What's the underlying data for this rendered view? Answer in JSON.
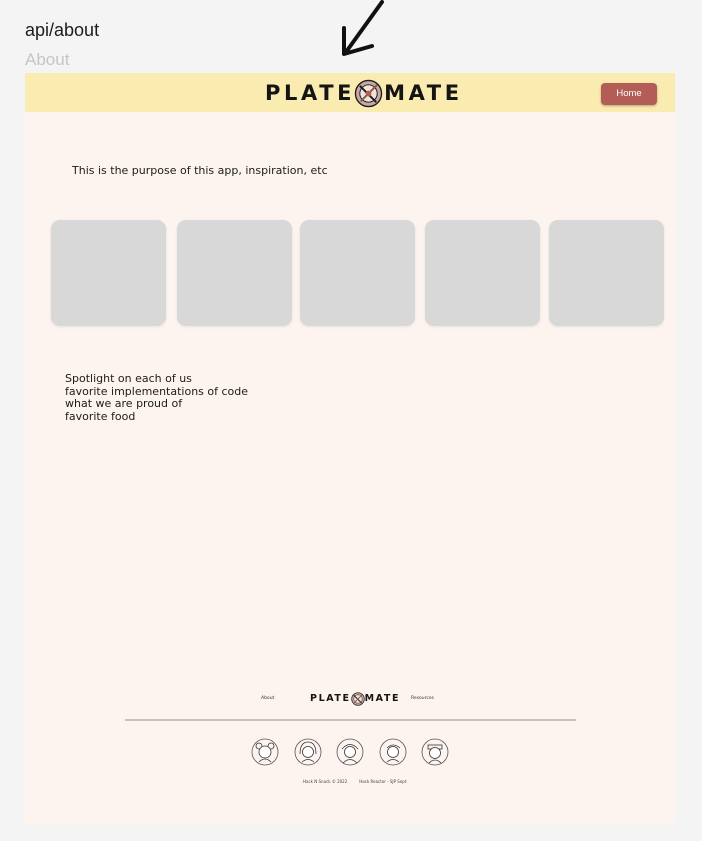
{
  "route_label": "api/about",
  "page_label": "About",
  "header": {
    "logo_left": "PLATE",
    "logo_right": "MATE",
    "home_button": "Home"
  },
  "main": {
    "purpose_text": "This is the purpose of this app, inspiration, etc",
    "card_count": 5,
    "spotlight_lines": [
      "Spotlight on each of us",
      "favorite implementations of code",
      "what we are proud of",
      "favorite food"
    ]
  },
  "footer": {
    "about_link": "About",
    "resources_link": "Resources",
    "logo_left": "PLATE",
    "logo_right": "MATE",
    "copyright": "Hack N Snack © 2022",
    "program": "Hack Reactor - SJP Sept"
  },
  "colors": {
    "header_bg": "#faebb0",
    "page_bg": "#fdf4ef",
    "button": "#b35d56",
    "card": "#d8d8d8"
  }
}
